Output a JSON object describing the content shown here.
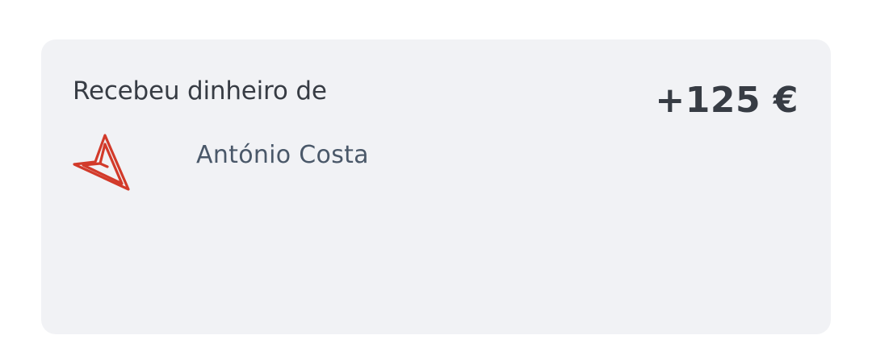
{
  "card": {
    "title": "Recebeu dinheiro de",
    "amount": "+125 €",
    "sender": {
      "name": "António Costa",
      "logo_icon": "red-paper-plane-logo-icon",
      "logo_color": "#d23a2a"
    }
  },
  "colors": {
    "card_background": "#f1f2f5",
    "primary_text": "#373c44",
    "secondary_text": "#4a5869"
  }
}
